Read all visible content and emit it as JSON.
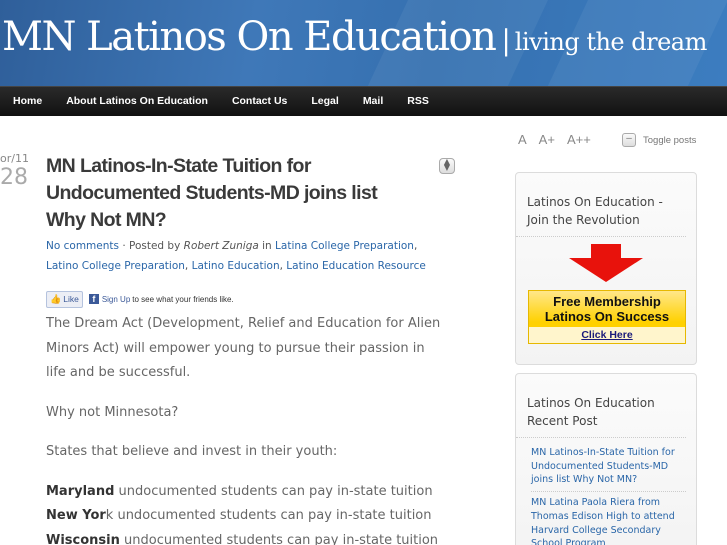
{
  "header": {
    "site_title": "MN Latinos On Education",
    "separator": "|",
    "tagline": "living the dream"
  },
  "nav": {
    "items": [
      "Home",
      "About Latinos On Education",
      "Contact Us",
      "Legal",
      "Mail",
      "RSS"
    ]
  },
  "post": {
    "date_month": "or/11",
    "date_day": "28",
    "title_lines": [
      "MN Latinos-In-State Tuition for",
      "Undocumented Students-MD joins list",
      "Why Not MN?"
    ],
    "meta": {
      "comments": "No comments",
      "posted_by": " · Posted by ",
      "author": "Robert Zuniga",
      "in": " in ",
      "categories": [
        "Latina College Preparation",
        "Latino College Preparation",
        "Latino Education",
        "Latino Education Resource"
      ]
    },
    "facebook": {
      "like": "Like",
      "signup": "Sign Up",
      "text": "to see what your friends like."
    },
    "paragraphs": [
      "The Dream Act (Development, Relief and Education for Alien Minors Act) will empower young to pursue their passion in life and be successful.",
      "Why not Minnesota?",
      "States that believe and invest in their youth:"
    ],
    "states": [
      {
        "bold": "Maryland",
        "rest": " undocumented students can pay in-state tuition"
      },
      {
        "bold": "New Yor",
        "rest": "k undocumented students can pay in-state tuition"
      },
      {
        "bold": "Wisconsin",
        "rest": " undocumented students can pay in-state tuition"
      }
    ]
  },
  "sidebar": {
    "font_sizes": [
      "A",
      "A+",
      "A++"
    ],
    "toggle_box": "–",
    "toggle_posts": "Toggle posts",
    "widget1": {
      "title": "Latinos On Education - Join the Revolution",
      "promo_line1": "Free Membership",
      "promo_line2": "Latinos On Success",
      "promo_cta": "Click Here",
      "arrow_color": "#e8120c"
    },
    "widget2": {
      "title": "Latinos On Education Recent Post",
      "posts": [
        "MN Latinos-In-State Tuition for Undocumented Students-MD joins list Why Not MN?",
        "MN Latina Paola Riera from Thomas Edison High to attend Harvard College Secondary School Program"
      ]
    }
  },
  "colors": {
    "header_blue": "#3570b0",
    "nav_black": "#111111",
    "link_blue": "#2a66a8",
    "promo_yellow": "#ffd100"
  }
}
